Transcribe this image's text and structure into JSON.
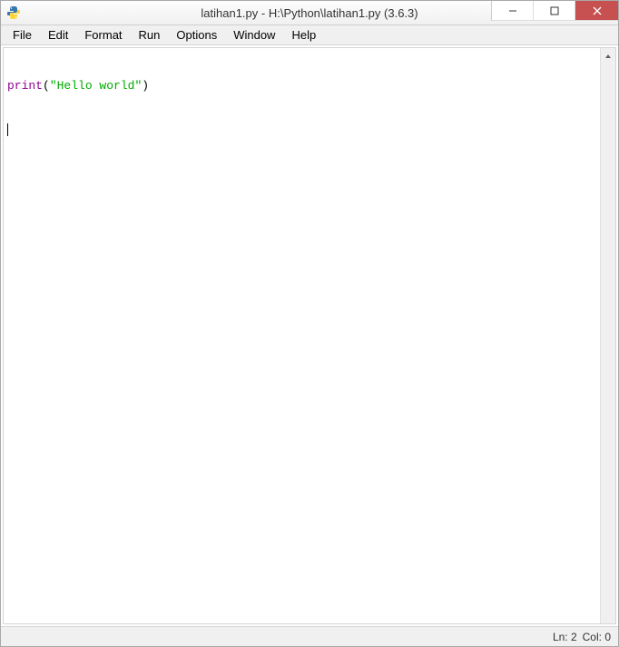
{
  "titlebar": {
    "title": "latihan1.py - H:\\Python\\latihan1.py (3.6.3)"
  },
  "window_controls": {
    "minimize": "─",
    "maximize": "▢",
    "close": "✕"
  },
  "menubar": {
    "items": [
      {
        "label": "File"
      },
      {
        "label": "Edit"
      },
      {
        "label": "Format"
      },
      {
        "label": "Run"
      },
      {
        "label": "Options"
      },
      {
        "label": "Window"
      },
      {
        "label": "Help"
      }
    ]
  },
  "editor": {
    "code": {
      "builtin": "print",
      "open_paren": "(",
      "string": "\"Hello world\"",
      "close_paren": ")"
    }
  },
  "statusbar": {
    "line": "Ln: 2",
    "col": "Col: 0"
  }
}
